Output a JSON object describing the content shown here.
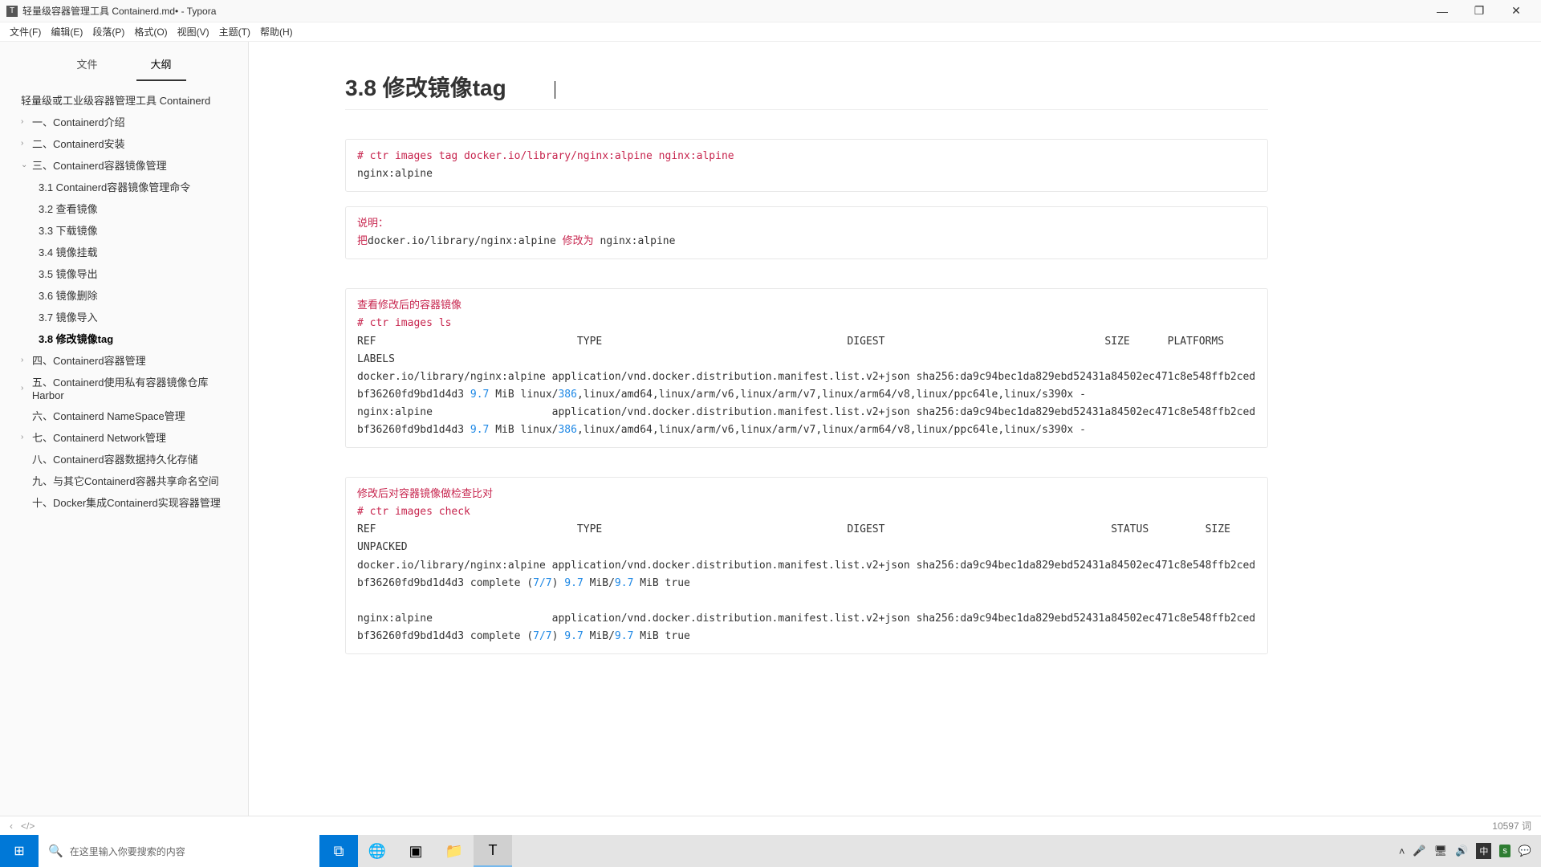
{
  "window": {
    "title": "轻量级容器管理工具 Containerd.md• - Typora"
  },
  "menu": {
    "file": "文件(F)",
    "edit": "编辑(E)",
    "paragraph": "段落(P)",
    "format": "格式(O)",
    "view": "视图(V)",
    "theme": "主题(T)",
    "help": "帮助(H)"
  },
  "sidebar": {
    "tab_file": "文件",
    "tab_outline": "大纲",
    "root": "轻量级或工业级容器管理工具 Containerd",
    "n1": "一、Containerd介绍",
    "n2": "二、Containerd安装",
    "n3": "三、Containerd容器镜像管理",
    "n3_1": "3.1 Containerd容器镜像管理命令",
    "n3_2": "3.2 查看镜像",
    "n3_3": "3.3 下载镜像",
    "n3_4": "3.4 镜像挂载",
    "n3_5": "3.5 镜像导出",
    "n3_6": "3.6 镜像删除",
    "n3_7": "3.7 镜像导入",
    "n3_8": "3.8 修改镜像tag",
    "n4": "四、Containerd容器管理",
    "n5": "五、Containerd使用私有容器镜像仓库 Harbor",
    "n6": "六、Containerd NameSpace管理",
    "n7": "七、Containerd Network管理",
    "n8": "八、Containerd容器数据持久化存储",
    "n9": "九、与其它Containerd容器共享命名空间",
    "n10": "十、Docker集成Containerd实现容器管理"
  },
  "doc": {
    "heading": "3.8 修改镜像tag",
    "block1_l1": "# ctr images tag docker.io/library/nginx:alpine nginx:alpine",
    "block1_l2": "nginx:alpine",
    "block2_l1a": "说明：",
    "block2_l2a": "把",
    "block2_l2b": "docker.io/library/nginx:alpine ",
    "block2_l2c": "修改为",
    "block2_l2d": " nginx:alpine",
    "block3_l1": "查看修改后的容器镜像",
    "block3_l2": "# ctr images ls",
    "block3_l3a": "REF                                TYPE                                       DIGEST                                   SIZE      PLATFORMS                               LABELS",
    "block3_l4a": "docker.io/library/nginx:alpine application/vnd.docker.distribution.manifest.list.v2+json sha256:da9c94bec1da829ebd52431a84502ec471c8e548ffb2cedbf36260fd9bd1d4d3 ",
    "block3_l4b": "9.7",
    "block3_l4c": " MiB linux/",
    "block3_l4d": "386",
    "block3_l4e": ",linux/amd64,linux/arm/v6,linux/arm/v7,linux/arm64/v8,linux/ppc64le,linux/s390x -",
    "block3_l5a": "nginx:alpine                   application/vnd.docker.distribution.manifest.list.v2+json sha256:da9c94bec1da829ebd52431a84502ec471c8e548ffb2cedbf36260fd9bd1d4d3 ",
    "block3_l5b": "9.7",
    "block3_l5c": " MiB linux/",
    "block3_l5d": "386",
    "block3_l5e": ",linux/amd64,linux/arm/v6,linux/arm/v7,linux/arm64/v8,linux/ppc64le,linux/s390x -",
    "block4_l1": "修改后对容器镜像做检查比对",
    "block4_l2": "# ctr images check",
    "block4_l3": "REF                                TYPE                                       DIGEST                                    STATUS         SIZE            UNPACKED",
    "block4_l4a": "docker.io/library/nginx:alpine application/vnd.docker.distribution.manifest.list.v2+json sha256:da9c94bec1da829ebd52431a84502ec471c8e548ffb2cedbf36260fd9bd1d4d3 complete (",
    "block4_l4b": "7/7",
    "block4_l4c": ") ",
    "block4_l4d": "9.7",
    "block4_l4e": " MiB/",
    "block4_l4f": "9.7",
    "block4_l4g": " MiB true",
    "block4_blank": "",
    "block4_l5a": "nginx:alpine                   application/vnd.docker.distribution.manifest.list.v2+json sha256:da9c94bec1da829ebd52431a84502ec471c8e548ffb2cedbf36260fd9bd1d4d3 complete (",
    "block4_l5b": "7/7",
    "block4_l5c": ") ",
    "block4_l5d": "9.7",
    "block4_l5e": " MiB/",
    "block4_l5f": "9.7",
    "block4_l5g": " MiB true"
  },
  "status": {
    "back": "‹",
    "code": "</>",
    "words": "10597 词"
  },
  "taskbar": {
    "search_placeholder": "在这里输入你要搜索的内容",
    "lang": "中",
    "ime": "s"
  }
}
